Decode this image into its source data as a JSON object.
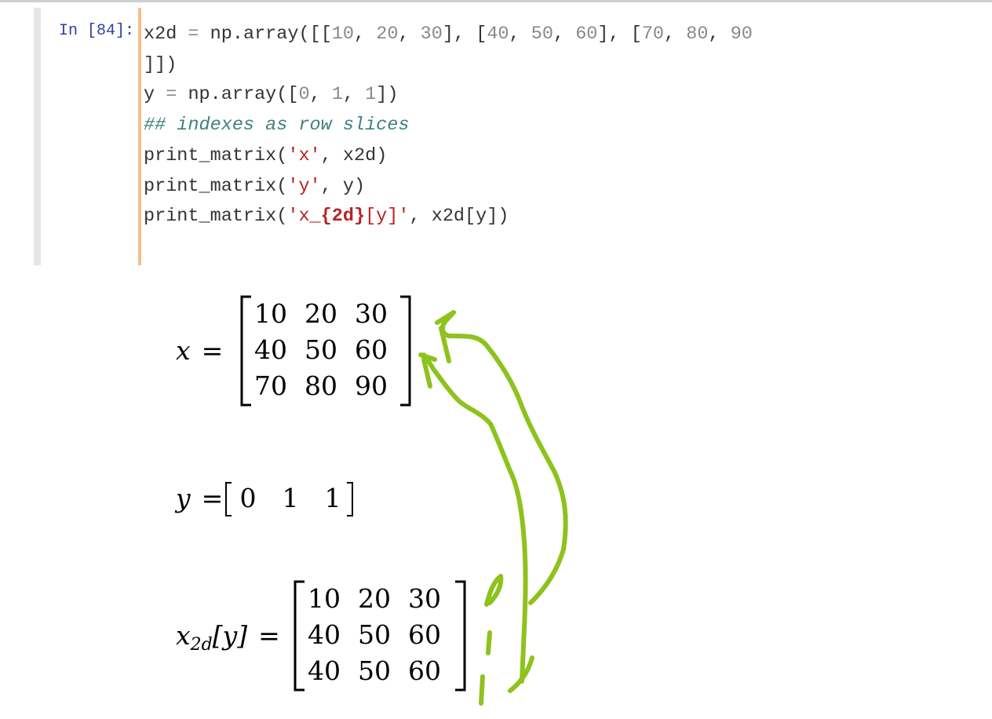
{
  "cell": {
    "prompt": "In [84]:",
    "code_lines": [
      "x2d = np.array([[10, 20, 30], [40, 50, 60], [70, 80, 90",
      "]])",
      "y = np.array([0, 1, 1])",
      "## indexes as row slices",
      "print_matrix('x', x2d)",
      "print_matrix('y', y)",
      "print_matrix('x_{2d}[y]', x2d[y])"
    ]
  },
  "output": {
    "x": {
      "label": "x",
      "equals": "=",
      "rows": [
        [
          "10",
          "20",
          "30"
        ],
        [
          "40",
          "50",
          "60"
        ],
        [
          "70",
          "80",
          "90"
        ]
      ]
    },
    "y": {
      "label": "y",
      "equals": "=",
      "values": [
        "0",
        "1",
        "1"
      ]
    },
    "x2d_y": {
      "label": "x",
      "subscript": "2d",
      "index": "[y]",
      "equals": "=",
      "rows": [
        [
          "10",
          "20",
          "30"
        ],
        [
          "40",
          "50",
          "60"
        ],
        [
          "40",
          "50",
          "60"
        ]
      ]
    }
  },
  "colors": {
    "prompt": "#303f9f",
    "cell_border": "#f5c08a",
    "string": "#ba2121",
    "comment": "#408080",
    "annotation": "#8ec21d"
  }
}
